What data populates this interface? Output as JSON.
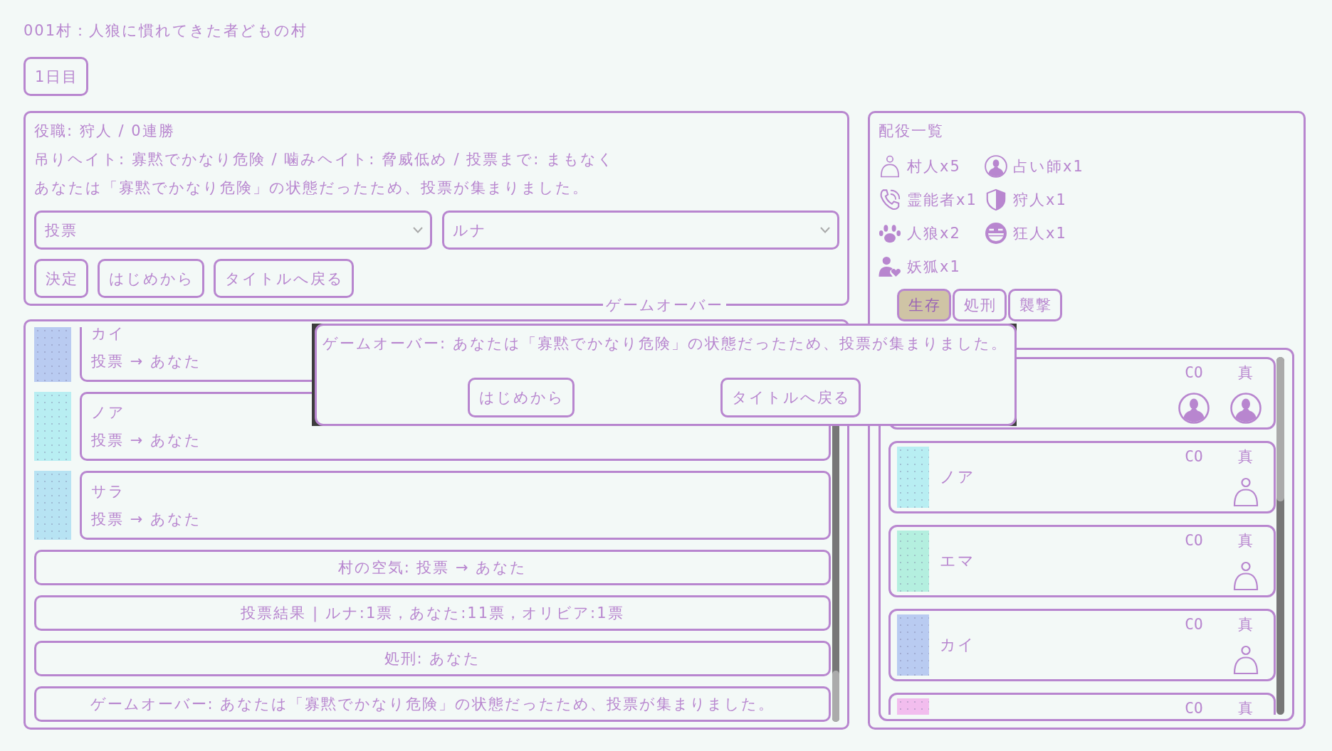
{
  "header": {
    "title": "001村：人狼に慣れてきた者どもの村",
    "day_button": "1日目"
  },
  "status_panel": {
    "lines": [
      "役職: 狩人 / 0連勝",
      "吊りヘイト: 寡黙でかなり危険 / 噛みヘイト: 脅威低め / 投票まで: まもなく",
      "あなたは「寡黙でかなり危険」の状態だったため、投票が集まりました。"
    ],
    "action_select": {
      "value": "投票"
    },
    "target_select": {
      "value": "ルナ"
    },
    "buttons": [
      "決定",
      "はじめから",
      "タイトルへ戻る"
    ]
  },
  "log": {
    "entries": [
      {
        "kind": "message",
        "speaker": "カイ",
        "text": "投票 → あなた",
        "color": "#b9cbf1"
      },
      {
        "kind": "message",
        "speaker": "ノア",
        "text": "投票 → あなた",
        "color": "#b8eef2"
      },
      {
        "kind": "message",
        "speaker": "サラ",
        "text": "投票 → あなた",
        "color": "#b7e3f3"
      },
      {
        "kind": "system",
        "text": "村の空気: 投票 → あなた"
      },
      {
        "kind": "system",
        "text": "投票結果 | ルナ:1票，あなた:11票，オリビア:1票"
      },
      {
        "kind": "system",
        "text": "処刑: あなた"
      },
      {
        "kind": "system",
        "text": "ゲームオーバー: あなたは「寡黙でかなり危険」の状態だったため、投票が集まりました。"
      }
    ]
  },
  "roles_panel": {
    "title": "配役一覧",
    "roles": [
      {
        "kind": "villager",
        "label": "村人x5"
      },
      {
        "kind": "seer",
        "label": "占い師x1"
      },
      {
        "kind": "medium",
        "label": "霊能者x1"
      },
      {
        "kind": "hunter",
        "label": "狩人x1"
      },
      {
        "kind": "werewolf",
        "label": "人狼x2"
      },
      {
        "kind": "madman",
        "label": "狂人x1"
      },
      {
        "kind": "fox",
        "label": "妖狐x1"
      }
    ],
    "tabs": [
      {
        "label": "生存",
        "selected": true
      },
      {
        "label": "処刑",
        "selected": false
      },
      {
        "label": "襲撃",
        "selected": false
      }
    ],
    "players": [
      {
        "co": {
          "label": "CO",
          "kind": "seer"
        },
        "truth": {
          "label": "真",
          "kind": "seer"
        }
      },
      {
        "name": "ノア",
        "color": "#b8eef2",
        "co": {
          "label": "CO"
        },
        "truth": {
          "label": "真",
          "kind": "villager"
        }
      },
      {
        "name": "エマ",
        "color": "#b4efdf",
        "co": {
          "label": "CO"
        },
        "truth": {
          "label": "真",
          "kind": "villager"
        }
      },
      {
        "name": "カイ",
        "color": "#b9cbf1",
        "co": {
          "label": "CO"
        },
        "truth": {
          "label": "真",
          "kind": "villager"
        }
      },
      {
        "color": "#f2bdee",
        "co": {
          "label": "CO"
        },
        "truth": {
          "label": "真"
        }
      }
    ]
  },
  "dialog": {
    "title": "ゲームオーバー",
    "message": "ゲームオーバー: あなたは「寡黙でかなり危険」の状態だったため、投票が集まりました。",
    "buttons": [
      "はじめから",
      "タイトルへ戻る"
    ]
  }
}
